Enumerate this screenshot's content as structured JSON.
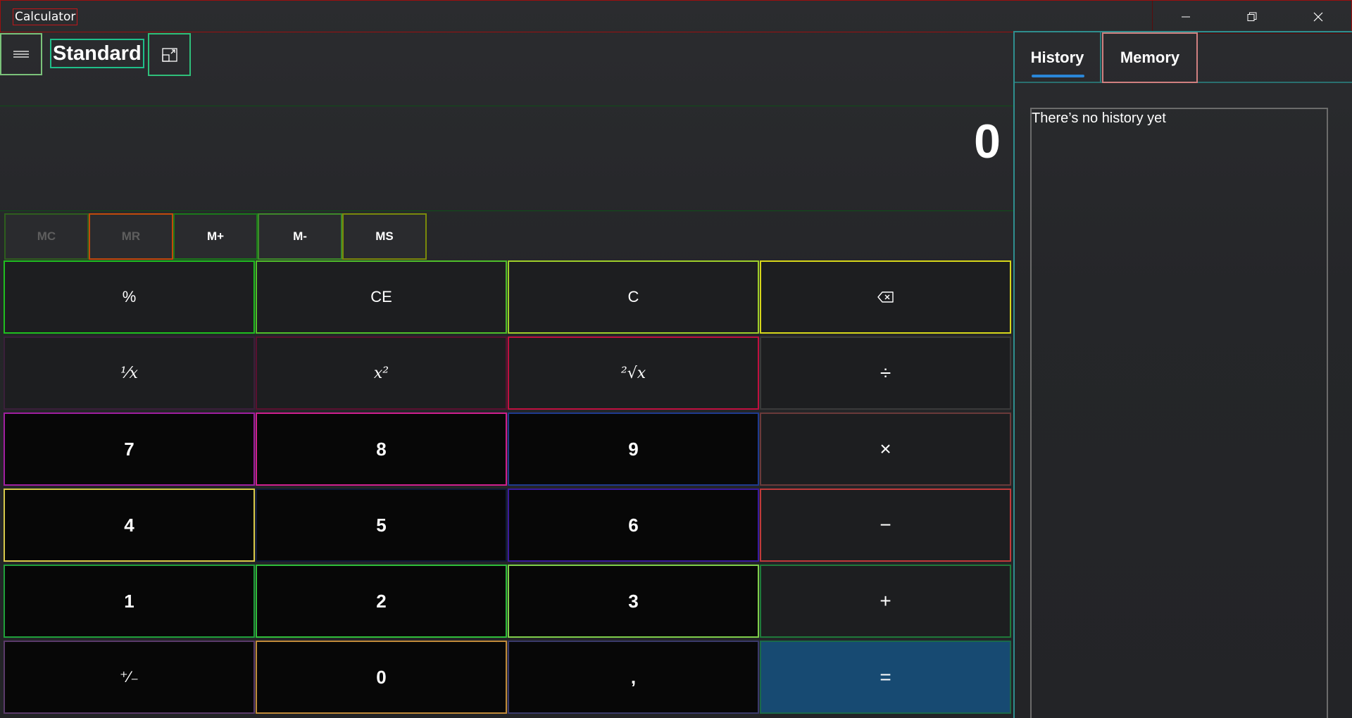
{
  "window": {
    "title": "Calculator",
    "caption_icons": [
      "minimize-icon",
      "restore-icon",
      "close-icon"
    ]
  },
  "header": {
    "mode_title": "Standard",
    "menu_icon": "hamburger-icon",
    "keep_on_top_icon": "keep-on-top-icon"
  },
  "display": {
    "value": "0"
  },
  "memory": {
    "mc": "MC",
    "mr": "MR",
    "m_plus": "M+",
    "m_minus": "M-",
    "ms": "MS",
    "disabled": [
      "mc",
      "mr"
    ]
  },
  "keypad": {
    "percent": "%",
    "ce": "CE",
    "c": "C",
    "backspace_icon": "backspace-icon",
    "reciprocal": "¹⁄x",
    "square": "x²",
    "sqrt": "²√x",
    "divide": "÷",
    "seven": "7",
    "eight": "8",
    "nine": "9",
    "multiply": "×",
    "four": "4",
    "five": "5",
    "six": "6",
    "minus": "−",
    "one": "1",
    "two": "2",
    "three": "3",
    "plus": "+",
    "negate": "⁺⁄₋",
    "zero": "0",
    "decimal": ",",
    "equals": "="
  },
  "side_pane": {
    "tabs": [
      {
        "label": "History",
        "active": true
      },
      {
        "label": "Memory",
        "active": false
      }
    ],
    "empty_message": "There’s no history yet"
  },
  "colors": {
    "equals_bg": "#174a72",
    "tab_accent": "#2a86d8"
  }
}
